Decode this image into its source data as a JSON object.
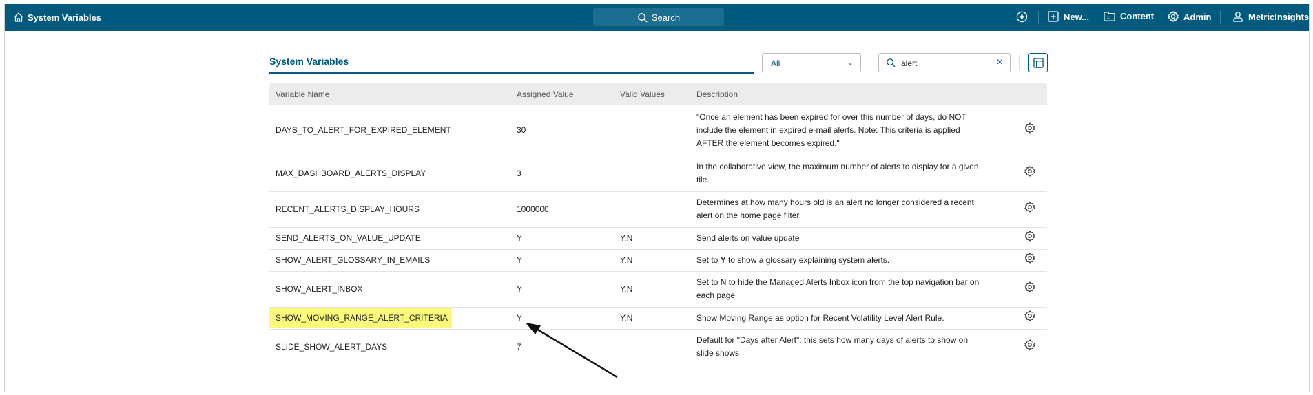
{
  "nav": {
    "title": "System Variables",
    "search": "Search",
    "new": "New...",
    "content": "Content",
    "admin": "Admin",
    "user": "MetricInsights"
  },
  "page": {
    "title": "System Variables",
    "filter": "All",
    "search_value": "alert"
  },
  "table": {
    "headers": [
      "Variable Name",
      "Assigned Value",
      "Valid Values",
      "Description"
    ],
    "rows": [
      {
        "name": "DAYS_TO_ALERT_FOR_EXPIRED_ELEMENT",
        "value": "30",
        "valid": "",
        "desc": "\"Once an element has been expired for over this number of days, do NOT include the element in expired e-mail alerts. Note: This criteria is applied AFTER the element becomes expired.\""
      },
      {
        "name": "MAX_DASHBOARD_ALERTS_DISPLAY",
        "value": "3",
        "valid": "",
        "desc": "In the collaborative view, the maximum number of alerts to display for a given tile."
      },
      {
        "name": "RECENT_ALERTS_DISPLAY_HOURS",
        "value": "1000000",
        "valid": "",
        "desc": "Determines at how many hours old is an alert no longer considered a recent alert on the home page filter."
      },
      {
        "name": "SEND_ALERTS_ON_VALUE_UPDATE",
        "value": "Y",
        "valid": "Y,N",
        "desc": "Send alerts on value update"
      },
      {
        "name": "SHOW_ALERT_GLOSSARY_IN_EMAILS",
        "value": "Y",
        "valid": "Y,N",
        "desc": "Set to Y to show a glossary explaining system alerts."
      },
      {
        "name": "SHOW_ALERT_INBOX",
        "value": "Y",
        "valid": "Y,N",
        "desc": "Set to N to hide the Managed Alerts Inbox icon from the top navigation bar on each page"
      },
      {
        "name": "SHOW_MOVING_RANGE_ALERT_CRITERIA",
        "value": "Y",
        "valid": "Y,N",
        "desc": "Show Moving Range as option for Recent Volatility Level Alert Rule.",
        "highlighted": true
      },
      {
        "name": "SLIDE_SHOW_ALERT_DAYS",
        "value": "7",
        "valid": "",
        "desc": "Default for \"Days after Alert\": this sets how many days of alerts to show on slide shows"
      }
    ]
  },
  "colors": {
    "brand": "#005a7d",
    "highlight": "#fbf97a"
  }
}
